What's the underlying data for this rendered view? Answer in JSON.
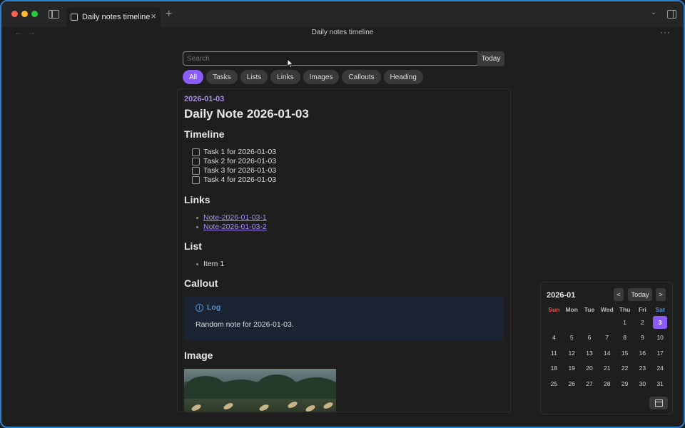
{
  "window": {
    "tab_title": "Daily notes timeline",
    "tab_close": "×",
    "new_tab": "+",
    "header_title": "Daily notes timeline",
    "more": "···",
    "back": "←",
    "forward": "→",
    "chevron": "⌄"
  },
  "search": {
    "placeholder": "Search",
    "value": ""
  },
  "today_label": "Today",
  "filters": [
    "All",
    "Tasks",
    "Lists",
    "Links",
    "Images",
    "Callouts",
    "Heading"
  ],
  "active_filter": "All",
  "note": {
    "date": "2026-01-03",
    "title": "Daily Note 2026-01-03",
    "timeline_heading": "Timeline",
    "tasks": [
      "Task 1 for 2026-01-03",
      "Task 2 for 2026-01-03",
      "Task 3 for 2026-01-03",
      "Task 4 for 2026-01-03"
    ],
    "links_heading": "Links",
    "links": [
      "Note-2026-01-03-1",
      "Note-2026-01-03-2"
    ],
    "list_heading": "List",
    "list_items": [
      "Item 1"
    ],
    "callout_heading": "Callout",
    "callout": {
      "icon": "i",
      "title": "Log",
      "body": "Random note for 2026-01-03."
    },
    "image_heading": "Image"
  },
  "calendar": {
    "month": "2026-01",
    "prev": "<",
    "today": "Today",
    "next": ">",
    "weekdays": [
      "Sun",
      "Mon",
      "Tue",
      "Wed",
      "Thu",
      "Fri",
      "Sat"
    ],
    "weeks": [
      [
        "",
        "",
        "",
        "",
        "1",
        "2",
        "3"
      ],
      [
        "4",
        "5",
        "6",
        "7",
        "8",
        "9",
        "10"
      ],
      [
        "11",
        "12",
        "13",
        "14",
        "15",
        "16",
        "17"
      ],
      [
        "18",
        "19",
        "20",
        "21",
        "22",
        "23",
        "24"
      ],
      [
        "25",
        "26",
        "27",
        "28",
        "29",
        "30",
        "31"
      ]
    ],
    "selected": "3"
  },
  "colors": {
    "accent": "#8b5cf6",
    "callout_blue": "#4a90e2",
    "window_border": "#2d7fd0"
  }
}
